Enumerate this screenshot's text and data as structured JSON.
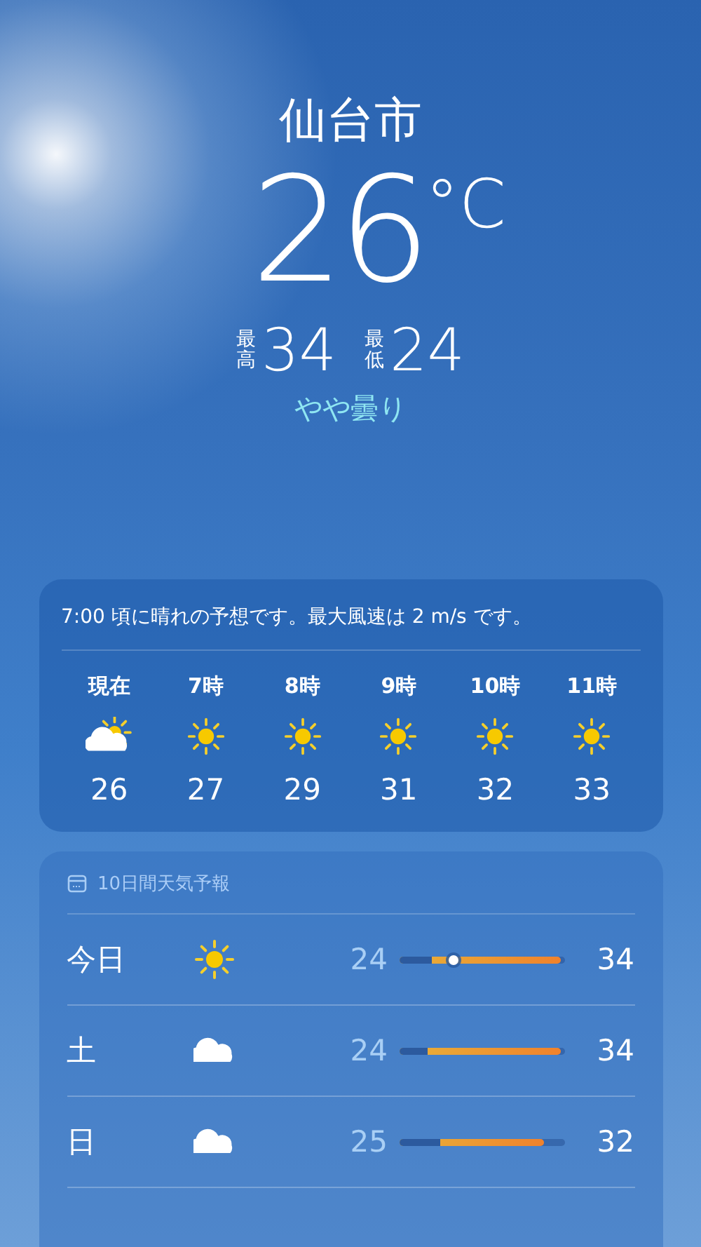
{
  "location": {
    "city": "仙台市",
    "temperature": "26",
    "unit": "°C",
    "high_label": "最高",
    "high": "34",
    "low_label": "最低",
    "low": "24",
    "condition": "やや曇り"
  },
  "hourly": {
    "summary": "7:00 頃に晴れの予想です。最大風速は 2 m/s です。",
    "hours": [
      {
        "time": "現在",
        "kind": "partly_cloudy",
        "temp": "26"
      },
      {
        "time": "7時",
        "kind": "sun",
        "temp": "27"
      },
      {
        "time": "8時",
        "kind": "sun",
        "temp": "29"
      },
      {
        "time": "9時",
        "kind": "sun",
        "temp": "31"
      },
      {
        "time": "10時",
        "kind": "sun",
        "temp": "32"
      },
      {
        "time": "11時",
        "kind": "sun",
        "temp": "33"
      }
    ]
  },
  "daily": {
    "title": "10日間天気予報",
    "days": [
      {
        "day": "今日",
        "kind": "sun",
        "low": "24",
        "high": "34",
        "bar_start": {
          "level": 0.2
        },
        "bar_end": {
          "level": 0.98
        },
        "now_marker": {
          "level": 0.33
        }
      },
      {
        "day": "土",
        "kind": "cloud",
        "low": "24",
        "high": "34",
        "bar_start": {
          "level": 0.17
        },
        "bar_end": {
          "level": 0.98
        }
      },
      {
        "day": "日",
        "kind": "cloud",
        "low": "25",
        "high": "32",
        "bar_start": {
          "level": 0.25
        },
        "bar_end": {
          "level": 0.88
        }
      }
    ]
  }
}
